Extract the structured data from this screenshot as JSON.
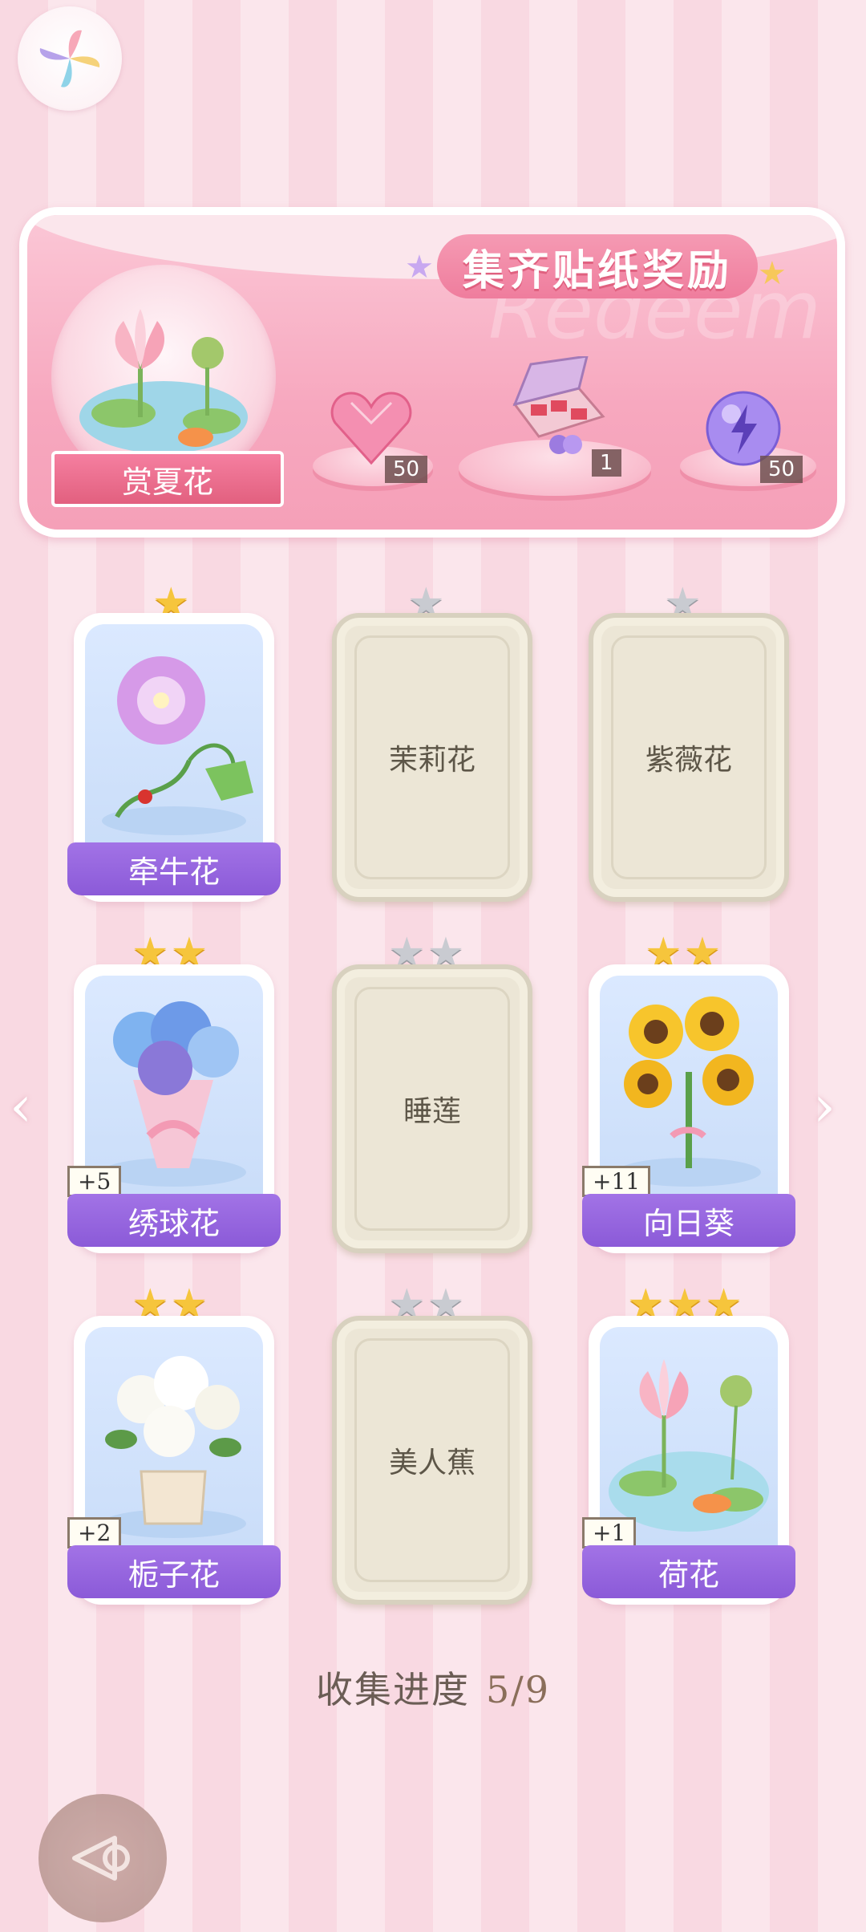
{
  "banner": {
    "title": "集齐贴纸奖励",
    "subtitle": "Redeem",
    "theme_label": "赏夏花",
    "rewards": [
      {
        "icon": "heart-gem-icon",
        "count": "50"
      },
      {
        "icon": "gift-box-icon",
        "count": "1"
      },
      {
        "icon": "energy-orb-icon",
        "count": "50"
      }
    ]
  },
  "cards": [
    {
      "name": "牵牛花",
      "collected": true,
      "stars": 1,
      "plus": "",
      "icon": "morning-glory-icon"
    },
    {
      "name": "茉莉花",
      "collected": false,
      "stars": 1
    },
    {
      "name": "紫薇花",
      "collected": false,
      "stars": 1
    },
    {
      "name": "绣球花",
      "collected": true,
      "stars": 2,
      "plus": "+5",
      "icon": "hydrangea-icon"
    },
    {
      "name": "睡莲",
      "collected": false,
      "stars": 2
    },
    {
      "name": "向日葵",
      "collected": true,
      "stars": 2,
      "plus": "+11",
      "icon": "sunflower-icon"
    },
    {
      "name": "栀子花",
      "collected": true,
      "stars": 2,
      "plus": "+2",
      "icon": "gardenia-icon"
    },
    {
      "name": "美人蕉",
      "collected": false,
      "stars": 2
    },
    {
      "name": "荷花",
      "collected": true,
      "stars": 3,
      "plus": "+1",
      "icon": "lotus-icon"
    }
  ],
  "progress": {
    "label": "收集进度",
    "value": "5/9",
    "collected": 5,
    "total": 9
  },
  "colors": {
    "accent": "#f08aa8",
    "band": "#9a66e0",
    "gold_star": "#f6c53c",
    "silver_star": "#c9cbd1"
  }
}
